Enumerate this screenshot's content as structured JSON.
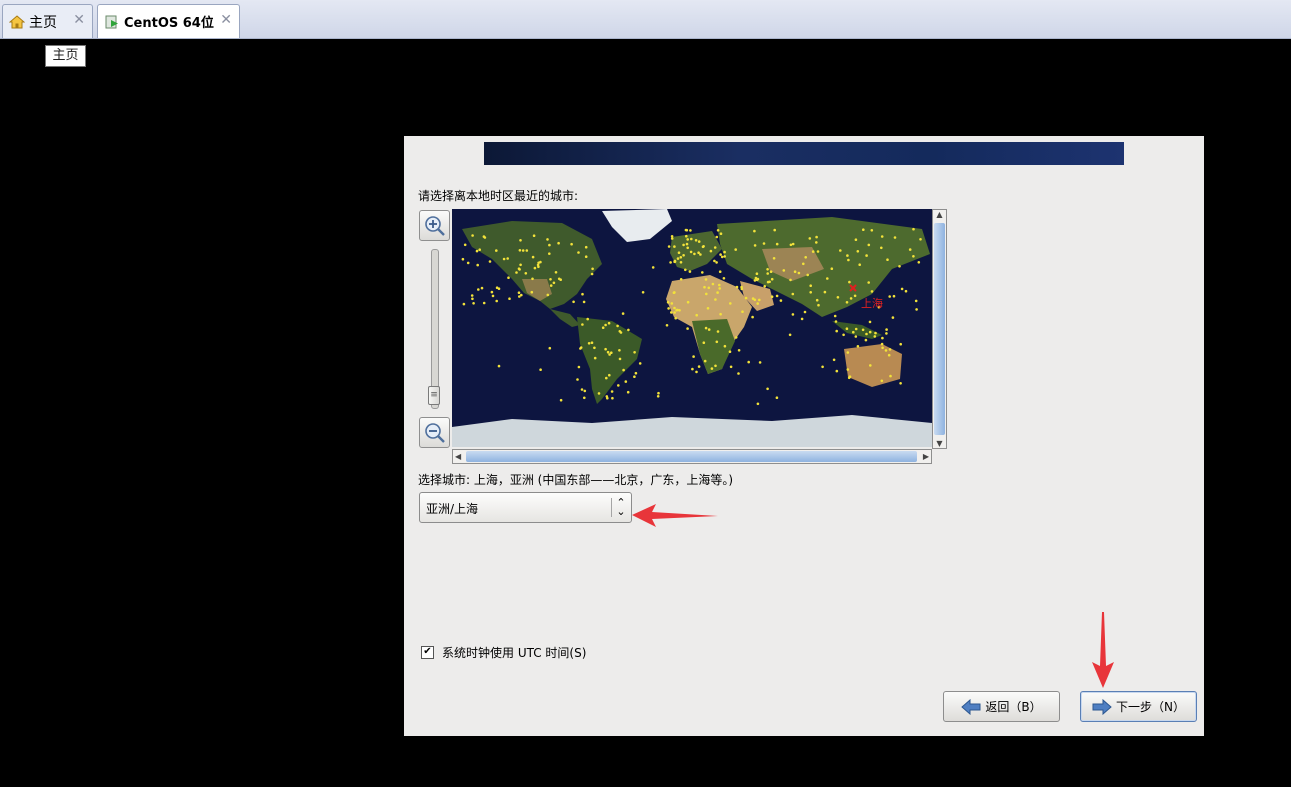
{
  "tabs": [
    {
      "label": "主页",
      "icon": "home-icon",
      "close": "✕"
    },
    {
      "label": "CentOS 64位",
      "icon": "vm-icon",
      "close": "✕"
    }
  ],
  "tooltip": "主页",
  "installer": {
    "prompt": "请选择离本地时区最近的城市:",
    "map_city_label": "上海",
    "selected_city": "选择城市: 上海，亚洲 (中国东部——北京，广东，上海等。)",
    "timezone_value": "亚洲/上海",
    "utc_label": "系统时钟使用 UTC 时间(S)",
    "utc_checked": true,
    "back_label": "返回（B）",
    "next_label": "下一步（N）"
  },
  "colors": {
    "annotation_arrow": "#e8353a",
    "banner": "#1a2e62",
    "scroll_thumb": "#8fb3e0"
  }
}
